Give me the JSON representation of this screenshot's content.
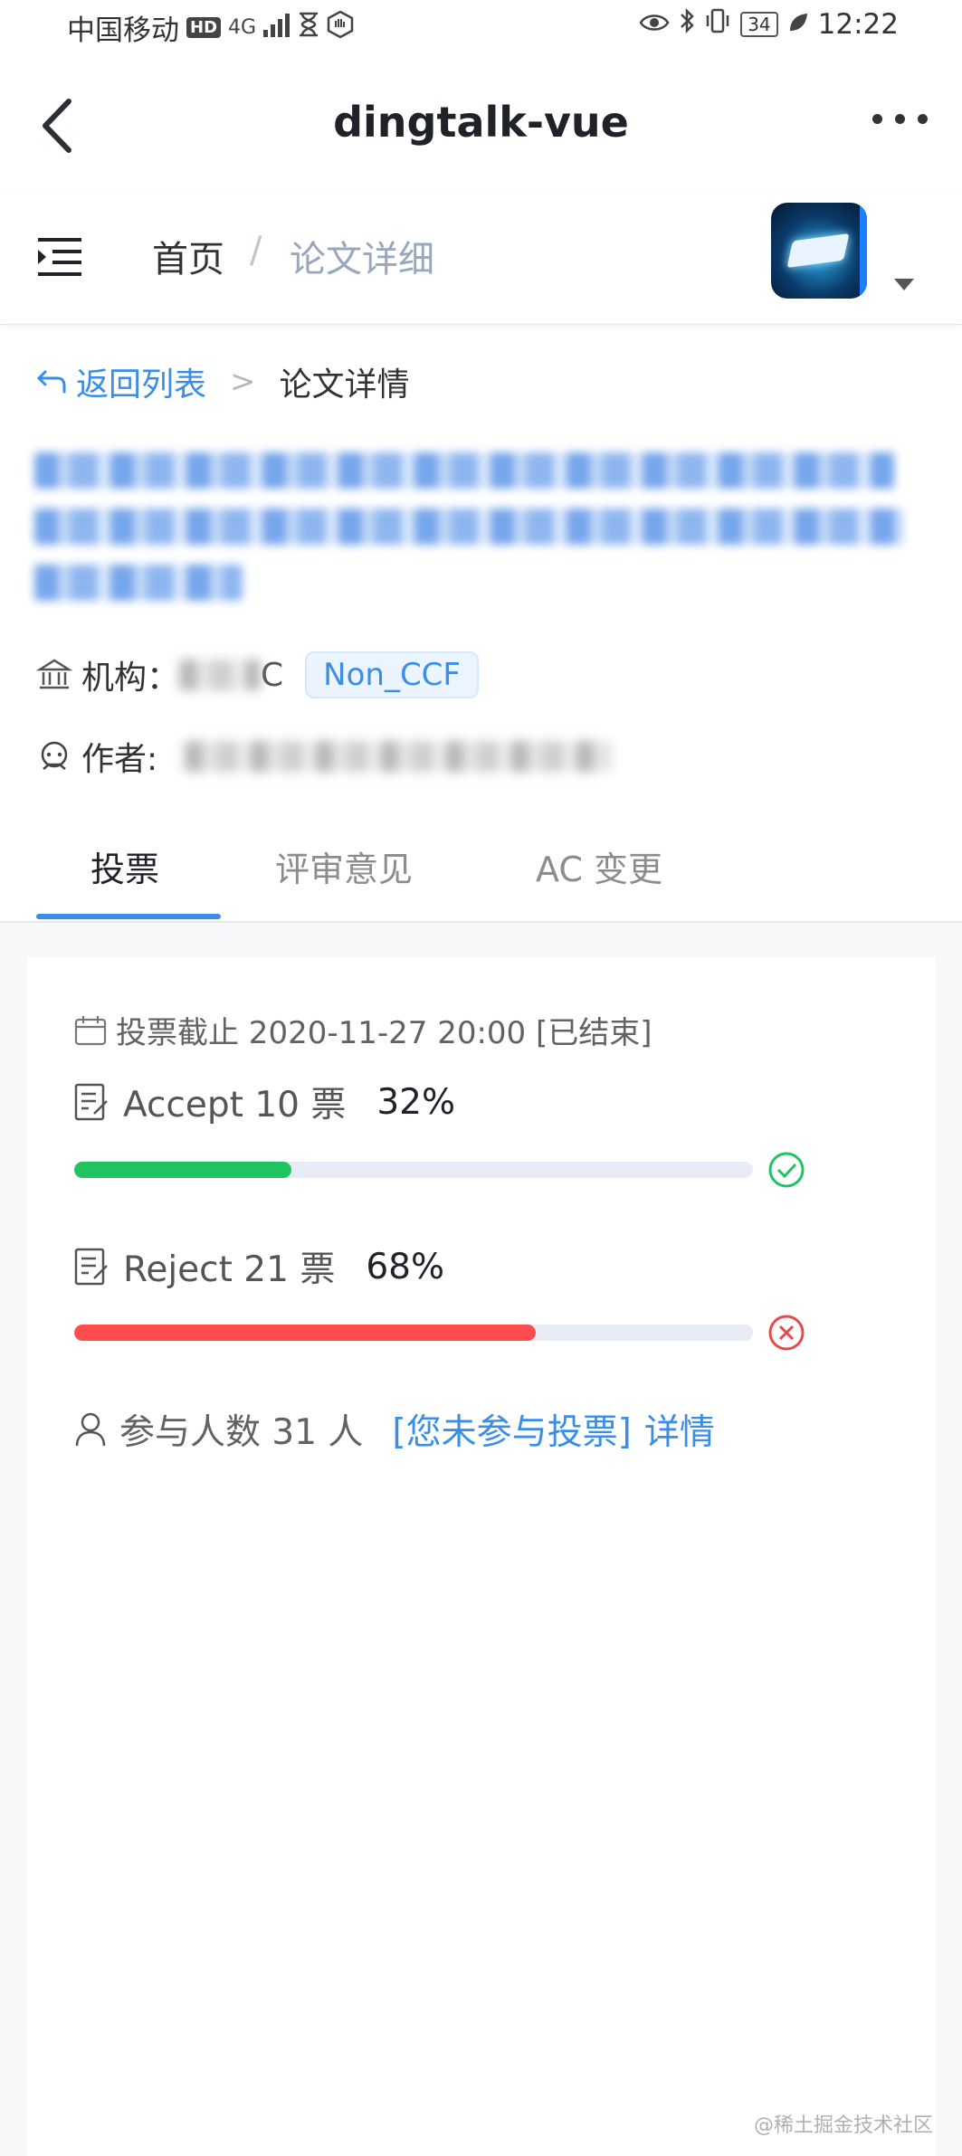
{
  "status_bar": {
    "carrier": "中国移动",
    "hd": "HD",
    "network": "4G",
    "battery": "34",
    "time": "12:22"
  },
  "titlebar": {
    "title": "dingtalk-vue",
    "back_icon": "chevron-left-icon",
    "more_icon": "more-dots-icon"
  },
  "navbar": {
    "menu_icon": "menu-indent-icon",
    "breadcrumb_home": "首页",
    "breadcrumb_sep": "/",
    "breadcrumb_current": "论文详细"
  },
  "sub_breadcrumb": {
    "back_label": "返回列表",
    "sep": ">",
    "current": "论文详情"
  },
  "paper": {
    "institution_label": "机构：",
    "institution_value_visible": "C",
    "tag": "Non_CCF",
    "author_label": "作者:"
  },
  "tabs": [
    {
      "label": "投票",
      "active": true
    },
    {
      "label": "评审意见",
      "active": false
    },
    {
      "label": "AC 变更",
      "active": false
    }
  ],
  "vote": {
    "deadline": "投票截止 2020-11-27 20:00 [已结束]",
    "accept": {
      "label": "Accept 10 票",
      "percent_text": "32%",
      "percent": 32,
      "color": "#1fc461",
      "icon": "check-circle-icon"
    },
    "reject": {
      "label": "Reject 21 票",
      "percent_text": "68%",
      "percent": 68,
      "color": "#ff4d4f",
      "icon": "close-circle-icon"
    },
    "participants": "参与人数 31 人",
    "not_voted": "[您未参与投票]",
    "details_link": "详情"
  },
  "watermark": "@稀土掘金技术社区",
  "colors": {
    "accent": "#3a8ee6"
  }
}
